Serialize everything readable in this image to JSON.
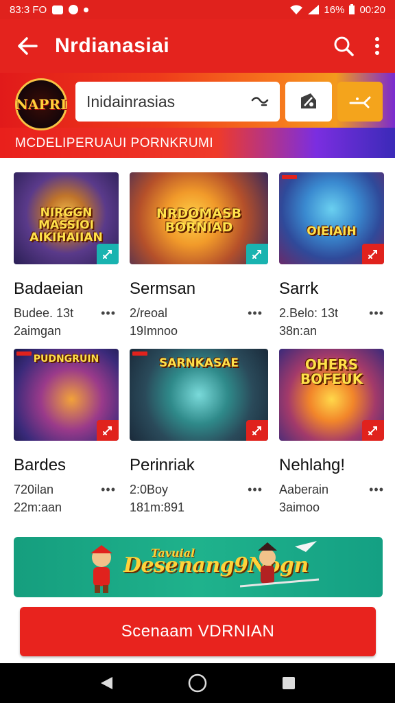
{
  "status_bar": {
    "time": "83:3 FO",
    "battery": "16%",
    "clock": "00:20"
  },
  "app_bar": {
    "title": "Nrdianasiai",
    "back_icon": "arrow-left-icon",
    "search_icon": "search-icon",
    "menu_icon": "more-vert-icon"
  },
  "banner": {
    "logo_text": "NAPRI",
    "search_value": "Inidainrasias",
    "tagline": "MCDELIPERUAUI PORNKRUMI"
  },
  "cards": [
    {
      "art_text": "NIRGGN MASSIOI AIKIHAIIAN",
      "name": "Badaeian",
      "meta1": "Budee. 13t",
      "meta2": "2aimgan",
      "badge_color": "#19b3b0"
    },
    {
      "art_text": "NRDOMASB BORNIAD",
      "name": "Sermsan",
      "meta1": "2/reoal",
      "meta2": "19Imnoo",
      "badge_color": "#19b3b0"
    },
    {
      "art_text": "OIEIAIH",
      "name": "Sarrk",
      "meta1": "2.Belo: 13t",
      "meta2": "38n:an",
      "badge_color": "#e0221d"
    },
    {
      "art_text": "PUDNGRUIN",
      "name": "Bardes",
      "meta1": "720ilan",
      "meta2": "22m:aan",
      "badge_color": "#e0221d"
    },
    {
      "art_text": "SARNKASAE",
      "name": "Perinriak",
      "meta1": "2:0Boy",
      "meta2": "181m:891",
      "badge_color": "#e0221d"
    },
    {
      "art_text": "OHERS BOFEUK",
      "name": "Nehlahg!",
      "meta1": "Aaberain",
      "meta2": "3aimoo",
      "badge_color": "#e0221d"
    }
  ],
  "promo": {
    "sup": "Tavuial",
    "main": "Desenang9Nogn"
  },
  "cta": {
    "label": "Scenaam VDRNIAN"
  },
  "more_label": "•••"
}
